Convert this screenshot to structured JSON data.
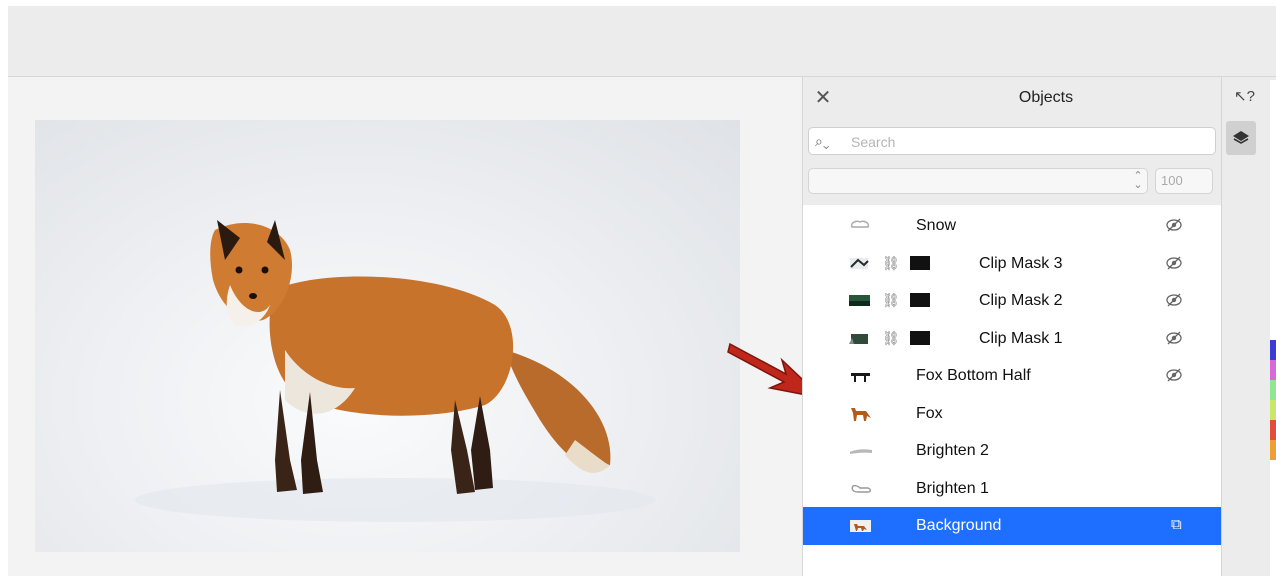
{
  "panel": {
    "title": "Objects",
    "close_icon": "close-icon",
    "search": {
      "placeholder": "Search",
      "value": ""
    },
    "opacity_value": "100"
  },
  "layers": [
    {
      "name": "Snow",
      "thumb": "snow",
      "clip": false,
      "visible_icon": true,
      "selected": false
    },
    {
      "name": "Clip Mask 3",
      "thumb": "clip3",
      "clip": true,
      "visible_icon": true,
      "selected": false
    },
    {
      "name": "Clip Mask 2",
      "thumb": "clip2",
      "clip": true,
      "visible_icon": true,
      "selected": false
    },
    {
      "name": "Clip Mask 1",
      "thumb": "clip1",
      "clip": true,
      "visible_icon": true,
      "selected": false
    },
    {
      "name": "Fox Bottom Half",
      "thumb": "foxhalf",
      "clip": false,
      "visible_icon": true,
      "selected": false
    },
    {
      "name": "Fox",
      "thumb": "fox",
      "clip": false,
      "visible_icon": false,
      "selected": false
    },
    {
      "name": "Brighten 2",
      "thumb": "brighten2",
      "clip": false,
      "visible_icon": false,
      "selected": false
    },
    {
      "name": "Brighten 1",
      "thumb": "brighten1",
      "clip": false,
      "visible_icon": false,
      "selected": false
    },
    {
      "name": "Background",
      "thumb": "background",
      "clip": false,
      "visible_icon": false,
      "selected": true
    }
  ],
  "colors": {
    "selection": "#1e6fff",
    "panel_bg": "#ececec",
    "arrow": "#c0271b"
  },
  "side": {
    "hint_icon": "hint-cursor-icon",
    "objects_tab_icon": "layers-icon"
  }
}
